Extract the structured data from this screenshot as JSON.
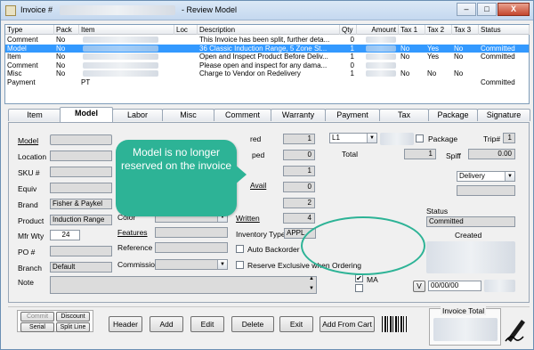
{
  "window": {
    "title": "Invoice #",
    "title_suffix": "- Review Model",
    "min_label": "–",
    "max_label": "□",
    "close_label": "X"
  },
  "list": {
    "columns": [
      "Type",
      "Pack",
      "Item",
      "Loc",
      "Description",
      "Qty",
      "Amount",
      "Tax 1",
      "Tax 2",
      "Tax 3",
      "Status"
    ],
    "rows": [
      {
        "type": "Comment",
        "pack": "No",
        "item": "",
        "loc": "",
        "description": "This Invoice has been split, further deta...",
        "qty": "0",
        "amount": "",
        "tax1": "",
        "tax2": "",
        "tax3": "",
        "status": ""
      },
      {
        "type": "Model",
        "pack": "No",
        "item": "",
        "loc": "",
        "description": "36 Classic Induction Range, 5 Zone St...",
        "qty": "1",
        "amount": "",
        "tax1": "No",
        "tax2": "Yes",
        "tax3": "No",
        "status": "Committed"
      },
      {
        "type": "Item",
        "pack": "No",
        "item": "",
        "loc": "",
        "description": "Open and Inspect Product Before Deliv...",
        "qty": "1",
        "amount": "",
        "tax1": "No",
        "tax2": "Yes",
        "tax3": "No",
        "status": "Committed"
      },
      {
        "type": "Comment",
        "pack": "No",
        "item": "",
        "loc": "",
        "description": "Please open and inspect for any dama...",
        "qty": "0",
        "amount": "",
        "tax1": "",
        "tax2": "",
        "tax3": "",
        "status": ""
      },
      {
        "type": "Misc",
        "pack": "No",
        "item": "",
        "loc": "",
        "description": "Charge to Vendor on Redelivery",
        "qty": "1",
        "amount": "",
        "tax1": "No",
        "tax2": "No",
        "tax3": "No",
        "status": ""
      },
      {
        "type": "Payment",
        "pack": "",
        "item": "PT",
        "loc": "",
        "description": "",
        "qty": "",
        "amount": "",
        "tax1": "",
        "tax2": "",
        "tax3": "",
        "status": "Committed"
      }
    ]
  },
  "tabs": [
    "Item",
    "Model",
    "Labor",
    "Misc",
    "Comment",
    "Warranty",
    "Payment",
    "Tax",
    "Package",
    "Signature"
  ],
  "form": {
    "model_label": "Model",
    "location_label": "Location",
    "sku_label": "SKU #",
    "equiv_label": "Equiv",
    "brand_label": "Brand",
    "brand_value": "Fisher & Paykel",
    "product_label": "Product",
    "product_value": "Induction Range",
    "mfr_wty_label": "Mfr Wty",
    "mfr_wty_value": "24",
    "po_label": "PO #",
    "branch_label": "Branch",
    "branch_value": "Default",
    "note_label": "Note",
    "color_label": "Color",
    "features_label": "Features",
    "reference_label": "Reference",
    "commission_label": "Commission",
    "ordered_label": "red",
    "ordered_value": "1",
    "shipped_label": "ped",
    "shipped_value": "0",
    "v3_value": "1",
    "avail_label": "Avail",
    "avail_value": "0",
    "v5_value": "2",
    "written_label": "Written",
    "written_value": "4",
    "inventory_type_label": "Inventory Type",
    "inventory_type_value": "APPL",
    "auto_backorder_label": "Auto Backorder",
    "reserve_label": "Reserve Exclusive when Ordering",
    "level_value": "L1",
    "total_label": "Total",
    "total_qty": "1",
    "package_label": "Package",
    "trip_label": "Trip#",
    "trip_value": "1",
    "spiff_label": "Spiff",
    "spiff_value": "0.00",
    "delivery_value": "Delivery",
    "status_label": "Status",
    "status_value": "Committed",
    "created_label": "Created",
    "ma_label": "MA",
    "v_label": "V",
    "date_value": "00/00/00"
  },
  "callout": {
    "text": "Model is no longer reserved on the invoice"
  },
  "buttons": {
    "commit": "Commit",
    "discount": "Discount",
    "serial": "Serial",
    "split_line": "Split Line",
    "header": "Header",
    "add": "Add",
    "edit": "Edit",
    "delete": "Delete",
    "exit": "Exit",
    "add_from_cart": "Add From Cart"
  },
  "invoice_total_label": "Invoice Total",
  "colors": {
    "selection": "#3399ff",
    "callout": "#2db396"
  }
}
